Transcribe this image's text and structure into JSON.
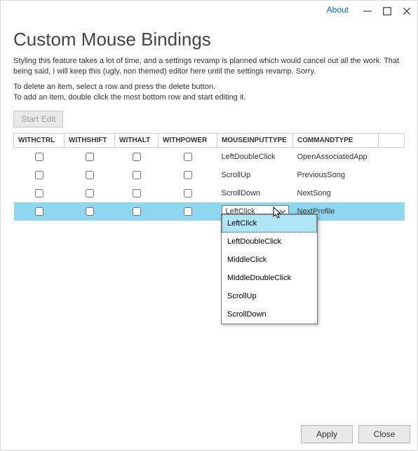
{
  "titlebar": {
    "about": "About"
  },
  "heading": "Custom Mouse Bindings",
  "desc1": "Styling this feature takes a lot of time, and a settings revamp is planned which would cancel out all the work. That being said, I will keep this (ugly, non themed) editor here until the settings revamp. Sorry.",
  "desc2a": "To delete an item, select a row and press the delete button.",
  "desc2b": "To add an item, double click the most bottom row and start editing it.",
  "start_edit": "Start Edit",
  "columns": [
    "WITHCTRL",
    "WITHSHIFT",
    "WITHALT",
    "WITHPOWER",
    "MOUSEINPUTTYPE",
    "COMMANDTYPE"
  ],
  "rows": [
    {
      "ctrl": false,
      "shift": false,
      "alt": false,
      "power": false,
      "input": "LeftDoubleClick",
      "command": "OpenAssociatedApp"
    },
    {
      "ctrl": false,
      "shift": false,
      "alt": false,
      "power": false,
      "input": "ScrollUp",
      "command": "PreviousSong"
    },
    {
      "ctrl": false,
      "shift": false,
      "alt": false,
      "power": false,
      "input": "ScrollDown",
      "command": "NextSong"
    },
    {
      "ctrl": false,
      "shift": false,
      "alt": false,
      "power": false,
      "input": "LeftClick",
      "command": "NextProfile"
    }
  ],
  "dropdown_options": [
    "LeftClick",
    "LeftDoubleClick",
    "MiddleClick",
    "MiddleDoubleClick",
    "ScrollUp",
    "ScrollDown"
  ],
  "selected_row": 3,
  "footer": {
    "apply": "Apply",
    "close": "Close"
  }
}
